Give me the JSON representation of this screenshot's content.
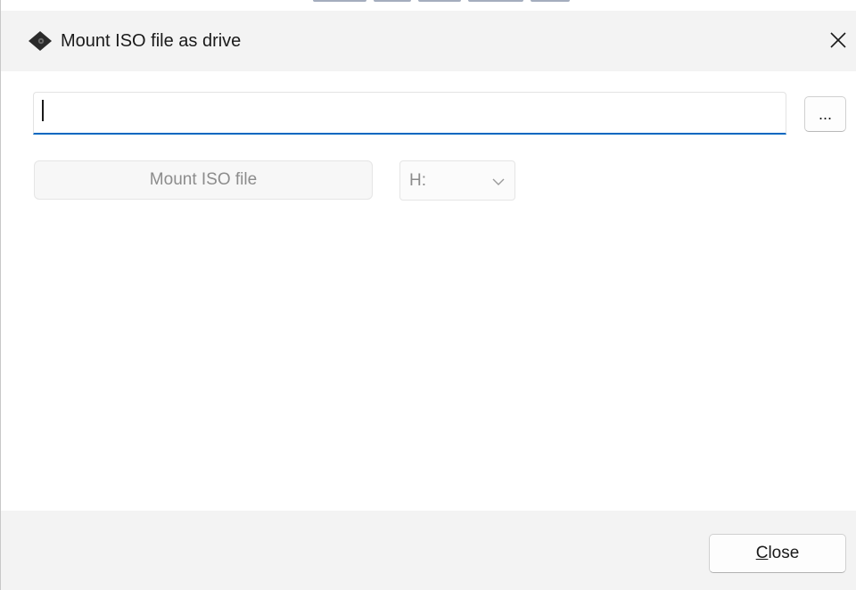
{
  "window": {
    "title": "Mount ISO file as drive",
    "icon": "disc-diamond-icon",
    "close_icon": "close-icon"
  },
  "form": {
    "iso_path": {
      "value": "",
      "placeholder": ""
    },
    "browse_label": "...",
    "mount_button_label": "Mount ISO file",
    "drive_letter": {
      "selected": "H:"
    }
  },
  "footer": {
    "close_mnemonic": "C",
    "close_rest": "lose"
  },
  "colors": {
    "accent": "#0067c0",
    "titlebar_bg": "#f3f3f3",
    "footer_bg": "#f3f3f3",
    "disabled_text": "#8c8c8c"
  }
}
